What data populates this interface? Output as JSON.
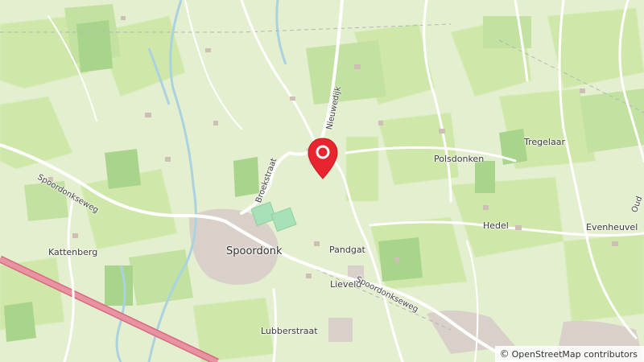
{
  "map": {
    "places": {
      "spoordonk": "Spoordonk",
      "kattenberg": "Kattenberg",
      "pandgat": "Pandgat",
      "lieveld": "Lieveld",
      "lubberstraat": "Lubberstraat",
      "polsdonken": "Polsdonken",
      "tregelaar": "Tregelaar",
      "hedel": "Hedel",
      "evenheuvel": "Evenheuvel",
      "oud": "Oud"
    },
    "roads": {
      "spoordonkseweg_w": "Spoordonkseweg",
      "spoordonkseweg_e": "Spoordonkseweg",
      "broekstraat": "Broekstraat",
      "nieuwedijk": "Nieuwedijk"
    },
    "marker": {
      "icon": "location-pin-icon",
      "color": "#e8242f"
    },
    "colors": {
      "land": "#e4efcf",
      "field": "#cfe8a9",
      "meadow": "#c3e1a0",
      "forest": "#a9d48c",
      "sports": "#a8e0b8",
      "river": "#aad3df",
      "motorway": "#e892a2",
      "built": "#d9d0c9"
    }
  },
  "attribution": {
    "symbol": "©",
    "text": "OpenStreetMap contributors"
  }
}
